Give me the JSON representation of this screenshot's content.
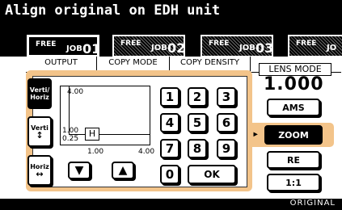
{
  "header": {
    "title": "Align original on EDH unit"
  },
  "jobs": [
    {
      "free": "FREE",
      "job_label": "JOB",
      "job_num": "01"
    },
    {
      "free": "FREE",
      "job_label": "JOB",
      "job_num": "02"
    },
    {
      "free": "FREE",
      "job_label": "JOB",
      "job_num": "03"
    },
    {
      "free": "FREE",
      "job_label": "JO",
      "job_num": ""
    }
  ],
  "mode_tabs": [
    "OUTPUT",
    "COPY MODE",
    "COPY DENSITY"
  ],
  "lens": {
    "tab_label": "LENS MODE",
    "ratio": "1.000",
    "buttons": [
      "AMS",
      "ZOOM",
      "RE",
      "1:1"
    ],
    "selected": "ZOOM",
    "pointer": "▸"
  },
  "zoom_panel": {
    "side_buttons": [
      {
        "line1": "Verti/",
        "line2": "Horiz",
        "active": true
      },
      {
        "line1": "Verti",
        "line2": "↕",
        "active": false
      },
      {
        "line1": "Horiz",
        "line2": "↔",
        "active": false
      }
    ],
    "graph": {
      "y_top": "4.00",
      "y_mid": "1.00",
      "y_bottom": "0.25",
      "x_left": "1.00",
      "x_right": "4.00",
      "marker": "H"
    },
    "keypad": [
      "1",
      "2",
      "3",
      "4",
      "5",
      "6",
      "7",
      "8",
      "9",
      "0"
    ],
    "ok": "OK",
    "arrows": {
      "down": "▼",
      "up": "▲"
    }
  },
  "status": {
    "text": "ORIGINAL"
  },
  "colors": {
    "accent": "#f3c48a",
    "screen": "#ffffff",
    "frame": "#000000"
  }
}
